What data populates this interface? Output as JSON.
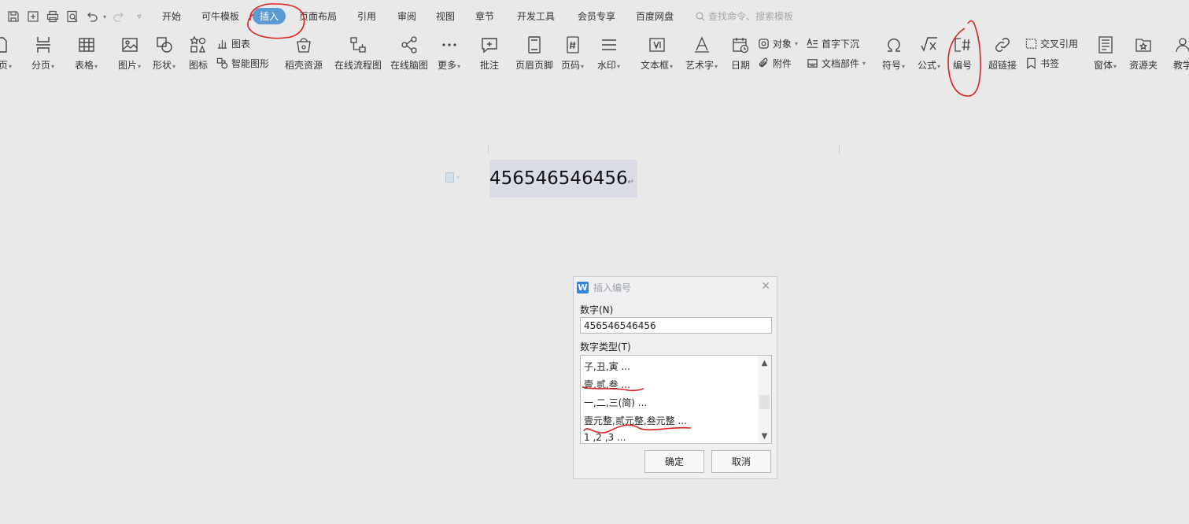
{
  "menu": {
    "tabs": [
      {
        "label": "开始"
      },
      {
        "label": "可牛模板"
      },
      {
        "label": "插入"
      },
      {
        "label": "页面布局"
      },
      {
        "label": "引用"
      },
      {
        "label": "审阅"
      },
      {
        "label": "视图"
      },
      {
        "label": "章节"
      },
      {
        "label": "开发工具"
      },
      {
        "label": "会员专享"
      },
      {
        "label": "百度网盘"
      }
    ],
    "active_tab": "插入",
    "search_placeholder": "查找命令、搜索模板"
  },
  "ribbon": {
    "buttons": [
      {
        "label": "白页",
        "icon": "blank-page-icon",
        "dropdown": true
      },
      {
        "label": "分页",
        "icon": "page-break-icon",
        "dropdown": true
      },
      {
        "label": "表格",
        "icon": "table-icon",
        "dropdown": true
      },
      {
        "label": "图片",
        "icon": "picture-icon",
        "dropdown": true
      },
      {
        "label": "形状",
        "icon": "shapes-icon",
        "dropdown": true
      },
      {
        "label": "图标",
        "icon": "icons-icon",
        "dropdown": false
      },
      {
        "label": "稻壳资源",
        "icon": "docer-resource-icon",
        "dropdown": false
      },
      {
        "label": "在线流程图",
        "icon": "flowchart-icon",
        "dropdown": false
      },
      {
        "label": "在线脑图",
        "icon": "mindmap-icon",
        "dropdown": false
      },
      {
        "label": "更多",
        "icon": "more-icon",
        "dropdown": true
      },
      {
        "label": "批注",
        "icon": "comment-icon",
        "dropdown": false
      },
      {
        "label": "页眉页脚",
        "icon": "header-footer-icon",
        "dropdown": false
      },
      {
        "label": "页码",
        "icon": "page-number-icon",
        "dropdown": true
      },
      {
        "label": "水印",
        "icon": "watermark-icon",
        "dropdown": true
      },
      {
        "label": "文本框",
        "icon": "textbox-icon",
        "dropdown": true
      },
      {
        "label": "艺术字",
        "icon": "wordart-icon",
        "dropdown": true
      },
      {
        "label": "日期",
        "icon": "date-icon",
        "dropdown": false
      },
      {
        "label": "符号",
        "icon": "symbol-icon",
        "dropdown": true
      },
      {
        "label": "公式",
        "icon": "formula-icon",
        "dropdown": true
      },
      {
        "label": "编号",
        "icon": "numbering-icon",
        "dropdown": false
      },
      {
        "label": "超链接",
        "icon": "hyperlink-icon",
        "dropdown": false
      },
      {
        "label": "窗体",
        "icon": "form-icon",
        "dropdown": true
      },
      {
        "label": "资源夹",
        "icon": "resource-folder-icon",
        "dropdown": false
      },
      {
        "label": "教学",
        "icon": "teaching-icon",
        "dropdown": false
      }
    ],
    "small": {
      "chart": "图表",
      "smart_graphic": "智能图形",
      "object": "对象",
      "attachment": "附件",
      "drop_cap": "首字下沉",
      "doc_parts": "文档部件",
      "cross_ref": "交叉引用",
      "bookmark": "书签"
    }
  },
  "document": {
    "text": "456546546456",
    "para_mark": "↵"
  },
  "dialog": {
    "title": "插入编号",
    "number_label": "数字(N)",
    "number_value": "456546546456",
    "type_label": "数字类型(T)",
    "types": [
      "子,丑,寅 ...",
      "壹,贰,叁 ...",
      "一,二,三(简) ...",
      "壹元整,贰元整,叁元整 ...",
      "1 ,2 ,3  ..."
    ],
    "ok": "确定",
    "cancel": "取消"
  },
  "colors": {
    "active_tab": "#5b9bd5",
    "annotation": "#e02020",
    "wps_logo": "#2e84e5",
    "selection": "#dadce8"
  }
}
